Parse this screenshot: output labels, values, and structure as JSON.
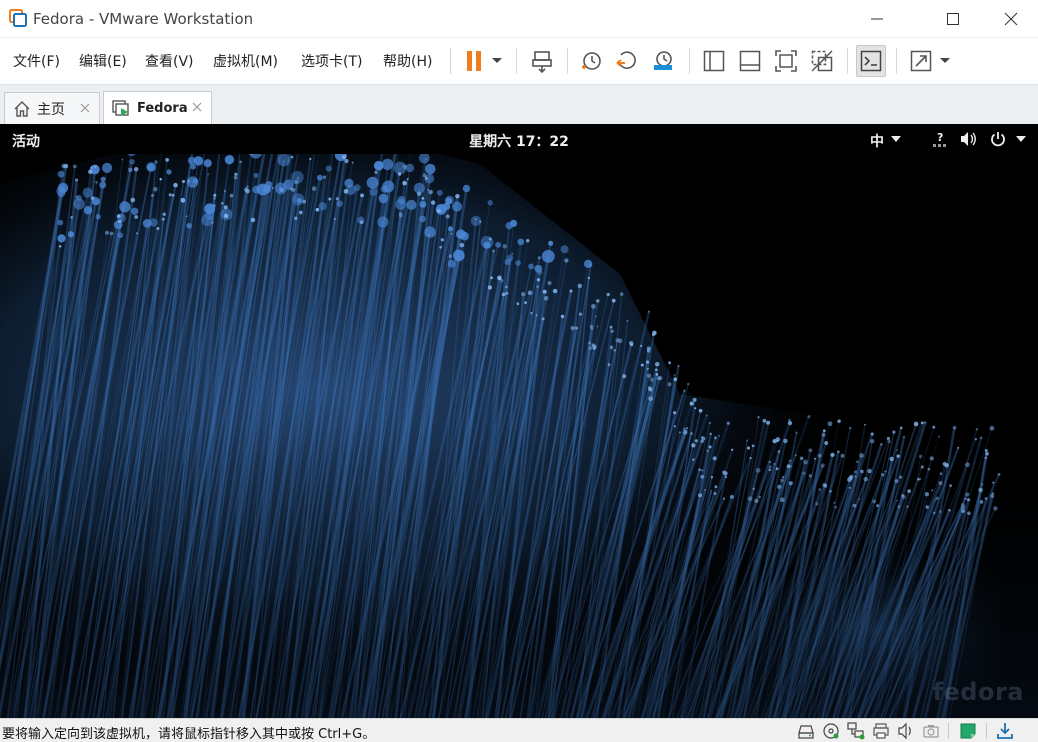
{
  "window": {
    "title": "Fedora - VMware Workstation",
    "icon": "vmware-logo-icon",
    "controls": [
      "minimize-icon",
      "maximize-icon",
      "close-icon"
    ]
  },
  "menu": {
    "items": [
      "文件(F)",
      "编辑(E)",
      "查看(V)",
      "虚拟机(M)",
      "选项卡(T)",
      "帮助(H)"
    ]
  },
  "toolbar": {
    "buttons": [
      "pause-icon",
      "dropdown-arrow-icon",
      "send-ctrl-alt-del-icon",
      "snapshot-take-icon",
      "snapshot-revert-icon",
      "snapshot-manager-icon",
      "library-view-icon",
      "thumbnail-bar-icon",
      "full-screen-icon",
      "unity-icon",
      "console-view-icon",
      "stretch-guest-icon",
      "dropdown-arrow-icon"
    ],
    "accent": "#f07d1d"
  },
  "tabs": [
    {
      "label": "主页",
      "icon": "home-icon",
      "active": false
    },
    {
      "label": "Fedora",
      "icon": "vm-running-icon",
      "active": true
    }
  ],
  "guest": {
    "activities": "活动",
    "clock": "星期六 17：22",
    "input_method": "中",
    "tray": [
      "network-unknown-icon",
      "volume-icon",
      "power-icon",
      "dropdown-arrow-icon"
    ],
    "watermark": "fedora",
    "wallpaper_color": "#3a6fb0"
  },
  "statusbar": {
    "text": "要将输入定向到该虚拟机，请将鼠标指针移入其中或按 Ctrl+G。",
    "icons": [
      "hard-disk-icon",
      "cd-dvd-icon",
      "network-adapter-icon",
      "usb-icon",
      "printer-icon",
      "sound-card-icon",
      "camera-icon",
      "message-log-icon",
      "download-icon"
    ]
  }
}
